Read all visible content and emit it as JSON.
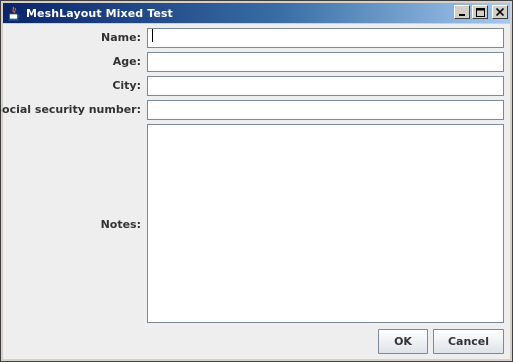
{
  "window": {
    "title": "MeshLayout Mixed Test",
    "icons": {
      "app": "java-cup-icon",
      "minimize": "minimize-icon",
      "maximize": "maximize-icon",
      "close": "close-icon"
    }
  },
  "form": {
    "name_label": "Name:",
    "name_value": "",
    "age_label": "Age:",
    "age_value": "",
    "city_label": "City:",
    "city_value": "",
    "ssn_label": "Social security number:",
    "ssn_value": "",
    "notes_label": "Notes:",
    "notes_value": ""
  },
  "buttons": {
    "ok": "OK",
    "cancel": "Cancel"
  },
  "colors": {
    "titlebar_start": "#0a246a",
    "titlebar_end": "#a6caf0",
    "panel_bg": "#eeeeee",
    "field_border": "#7a8a99"
  }
}
